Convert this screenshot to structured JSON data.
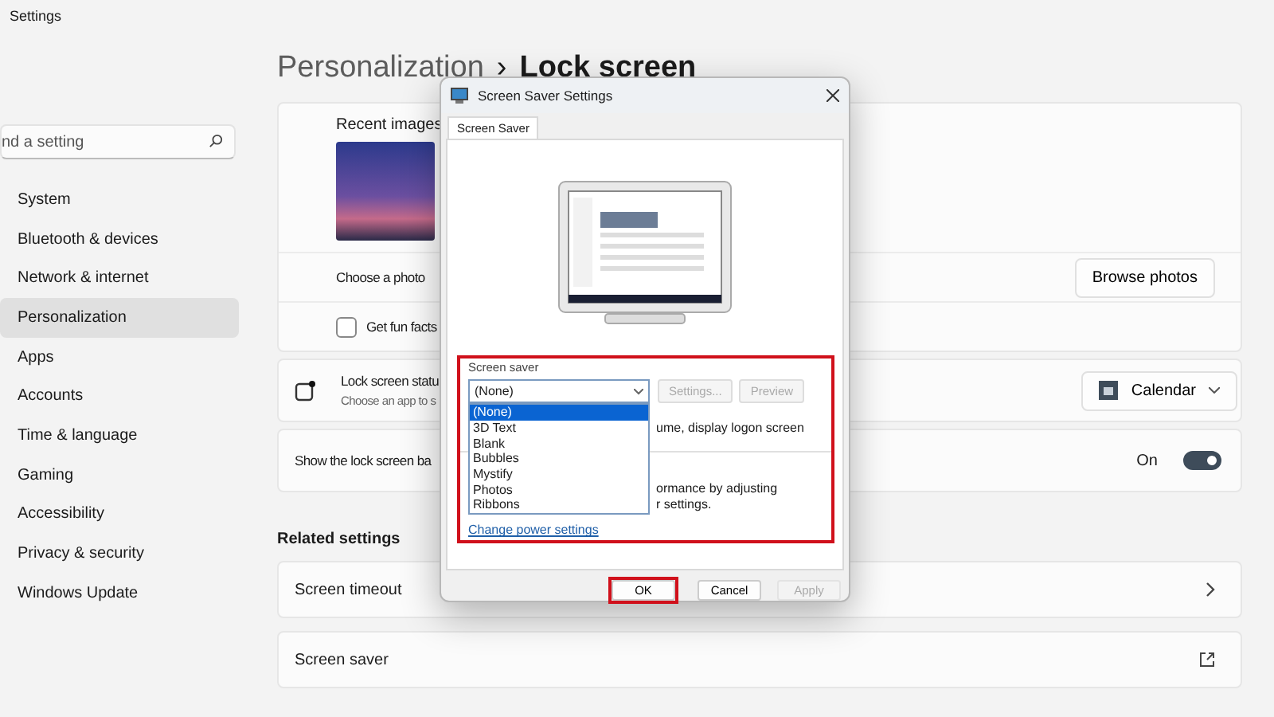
{
  "window": {
    "title": "Settings"
  },
  "search": {
    "placeholder": "nd a setting"
  },
  "sidebar": {
    "items": [
      {
        "label": "System",
        "selected": false
      },
      {
        "label": "Bluetooth & devices",
        "selected": false
      },
      {
        "label": "Network & internet",
        "selected": false
      },
      {
        "label": "Personalization",
        "selected": true
      },
      {
        "label": "Apps",
        "selected": false
      },
      {
        "label": "Accounts",
        "selected": false
      },
      {
        "label": "Time & language",
        "selected": false
      },
      {
        "label": "Gaming",
        "selected": false
      },
      {
        "label": "Accessibility",
        "selected": false
      },
      {
        "label": "Privacy & security",
        "selected": false
      },
      {
        "label": "Windows Update",
        "selected": false
      }
    ]
  },
  "breadcrumb": {
    "parent": "Personalization",
    "separator": "›",
    "current": "Lock screen"
  },
  "lock_screen": {
    "recent_images_label": "Recent images",
    "choose_photo": {
      "label": "Choose a photo",
      "button": "Browse photos"
    },
    "fun_facts": {
      "label": "Get fun facts",
      "checked": false
    },
    "status": {
      "title": "Lock screen statu",
      "subtitle": "Choose an app to s",
      "app": "Calendar"
    },
    "show_background": {
      "label": "Show the lock screen ba",
      "state_label": "On",
      "on": true
    }
  },
  "related": {
    "heading": "Related settings",
    "items": [
      {
        "label": "Screen timeout",
        "kind": "chevron"
      },
      {
        "label": "Screen saver",
        "kind": "external"
      }
    ]
  },
  "dialog": {
    "title": "Screen Saver Settings",
    "tabs": [
      {
        "label": "Screen Saver",
        "selected": true
      }
    ],
    "group_label": "Screen saver",
    "dropdown": {
      "value": "(None)",
      "expanded": true,
      "options": [
        {
          "label": "(None)",
          "selected": true
        },
        {
          "label": "3D Text",
          "selected": false
        },
        {
          "label": "Blank",
          "selected": false
        },
        {
          "label": "Bubbles",
          "selected": false
        },
        {
          "label": "Mystify",
          "selected": false
        },
        {
          "label": "Photos",
          "selected": false
        },
        {
          "label": "Ribbons",
          "selected": false
        }
      ]
    },
    "buttons": [
      {
        "label": "Settings...",
        "disabled": true
      },
      {
        "label": "Preview",
        "disabled": true
      }
    ],
    "resume_text": "ume, display logon screen",
    "power_text": [
      "ormance by adjusting",
      "r settings."
    ],
    "link": "Change power settings",
    "footer_buttons": [
      {
        "label": "OK",
        "disabled": false,
        "highlighted": true
      },
      {
        "label": "Cancel",
        "disabled": false,
        "highlighted": false
      },
      {
        "label": "Apply",
        "disabled": true,
        "highlighted": false
      }
    ]
  }
}
